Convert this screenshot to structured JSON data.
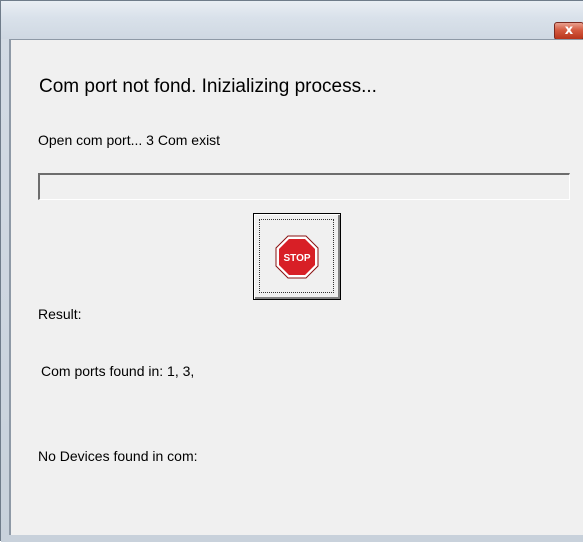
{
  "window": {
    "close_label": "x"
  },
  "heading": "Com port not fond. Inizializing process...",
  "status": "Open com port... 3 Com exist",
  "progress": {
    "value": 0
  },
  "stop_button": {
    "icon": "stop-sign-icon",
    "icon_text": "STOP"
  },
  "result": {
    "label": "Result:",
    "ports_found": "Com ports found in: 1, 3,",
    "no_devices": "No Devices found in com:"
  },
  "colors": {
    "stop_red": "#d81f26",
    "close_red": "#c8432b"
  }
}
